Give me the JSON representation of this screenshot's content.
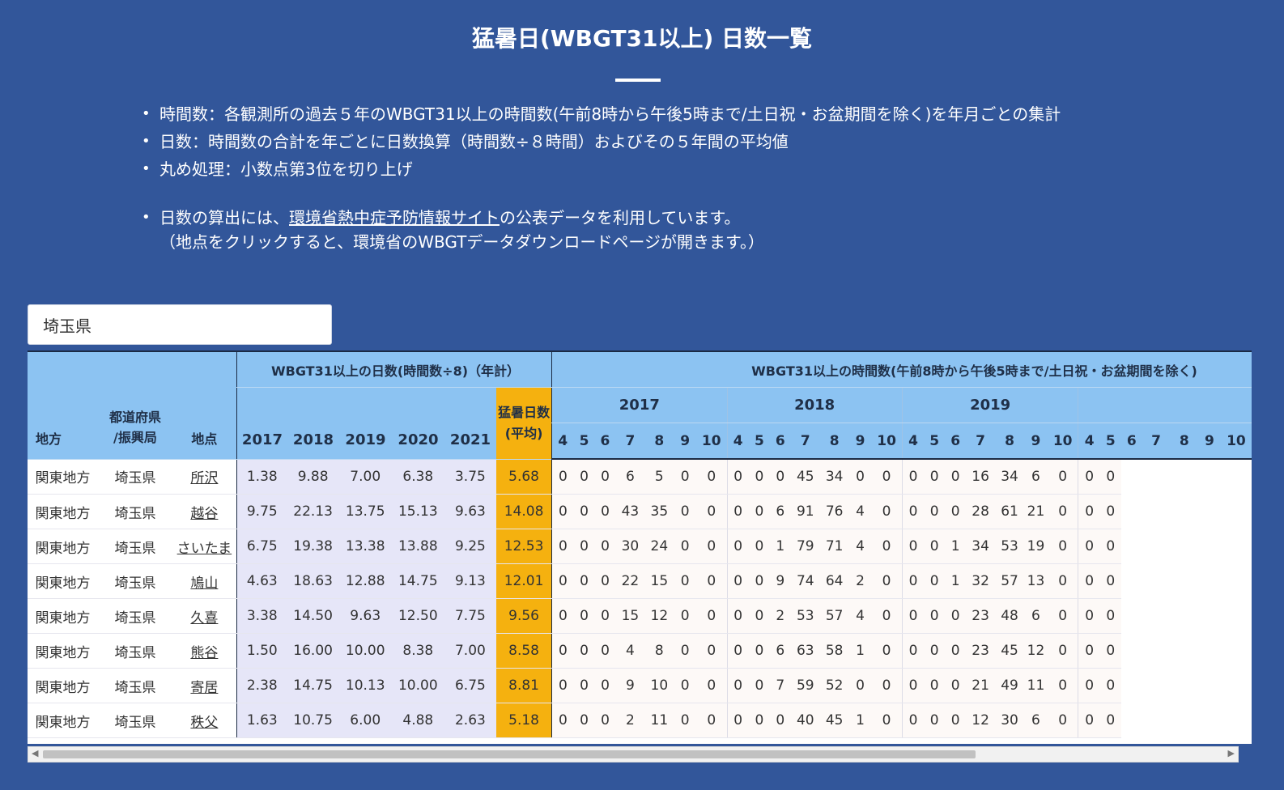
{
  "page": {
    "title": "猛暑日(WBGT31以上) 日数一覧",
    "notes": [
      "時間数：各観測所の過去５年のWBGT31以上の時間数(午前8時から午後5時まで/土日祝・お盆期間を除く)を年月ごとの集計",
      "日数：時間数の合計を年ごとに日数換算（時間数÷８時間）およびその５年間の平均値",
      "丸め処理：小数点第3位を切り上げ"
    ],
    "source_note_prefix": "日数の算出には、",
    "source_link": "環境省熱中症予防情報サイト",
    "source_note_suffix": "の公表データを利用しています。",
    "source_sub": "（地点をクリックすると、環境省のWBGTデータダウンロードページが開きます。）"
  },
  "filter": {
    "prefecture": "埼玉県"
  },
  "table": {
    "head": {
      "region": "地方",
      "pref": "都道府県\n/振興局",
      "site": "地点",
      "days_group": "WBGT31以上の日数(時間数÷8)（年計）",
      "hours_group": "WBGT31以上の時間数(午前8時から午後5時まで/土日祝・お盆期間を除く)",
      "avg": "猛暑日数\n(平均)",
      "day_years": [
        "2017",
        "2018",
        "2019",
        "2020",
        "2021"
      ],
      "hour_years": [
        "2017",
        "2018",
        "2019",
        ""
      ],
      "months": [
        "4",
        "5",
        "6",
        "7",
        "8",
        "9",
        "10"
      ]
    },
    "rows": [
      {
        "region": "関東地方",
        "pref": "埼玉県",
        "site": "所沢",
        "days": [
          "1.38",
          "9.88",
          "7.00",
          "6.38",
          "3.75"
        ],
        "avg": "5.68",
        "hours": [
          "0",
          "0",
          "0",
          "6",
          "5",
          "0",
          "0",
          "0",
          "0",
          "0",
          "45",
          "34",
          "0",
          "0",
          "0",
          "0",
          "0",
          "16",
          "34",
          "6",
          "0",
          "0",
          "0"
        ]
      },
      {
        "region": "関東地方",
        "pref": "埼玉県",
        "site": "越谷",
        "days": [
          "9.75",
          "22.13",
          "13.75",
          "15.13",
          "9.63"
        ],
        "avg": "14.08",
        "hours": [
          "0",
          "0",
          "0",
          "43",
          "35",
          "0",
          "0",
          "0",
          "0",
          "6",
          "91",
          "76",
          "4",
          "0",
          "0",
          "0",
          "0",
          "28",
          "61",
          "21",
          "0",
          "0",
          "0"
        ]
      },
      {
        "region": "関東地方",
        "pref": "埼玉県",
        "site": "さいたま",
        "days": [
          "6.75",
          "19.38",
          "13.38",
          "13.88",
          "9.25"
        ],
        "avg": "12.53",
        "hours": [
          "0",
          "0",
          "0",
          "30",
          "24",
          "0",
          "0",
          "0",
          "0",
          "1",
          "79",
          "71",
          "4",
          "0",
          "0",
          "0",
          "1",
          "34",
          "53",
          "19",
          "0",
          "0",
          "0"
        ]
      },
      {
        "region": "関東地方",
        "pref": "埼玉県",
        "site": "鳩山",
        "days": [
          "4.63",
          "18.63",
          "12.88",
          "14.75",
          "9.13"
        ],
        "avg": "12.01",
        "hours": [
          "0",
          "0",
          "0",
          "22",
          "15",
          "0",
          "0",
          "0",
          "0",
          "9",
          "74",
          "64",
          "2",
          "0",
          "0",
          "0",
          "1",
          "32",
          "57",
          "13",
          "0",
          "0",
          "0"
        ]
      },
      {
        "region": "関東地方",
        "pref": "埼玉県",
        "site": "久喜",
        "days": [
          "3.38",
          "14.50",
          "9.63",
          "12.50",
          "7.75"
        ],
        "avg": "9.56",
        "hours": [
          "0",
          "0",
          "0",
          "15",
          "12",
          "0",
          "0",
          "0",
          "0",
          "2",
          "53",
          "57",
          "4",
          "0",
          "0",
          "0",
          "0",
          "23",
          "48",
          "6",
          "0",
          "0",
          "0"
        ]
      },
      {
        "region": "関東地方",
        "pref": "埼玉県",
        "site": "熊谷",
        "days": [
          "1.50",
          "16.00",
          "10.00",
          "8.38",
          "7.00"
        ],
        "avg": "8.58",
        "hours": [
          "0",
          "0",
          "0",
          "4",
          "8",
          "0",
          "0",
          "0",
          "0",
          "6",
          "63",
          "58",
          "1",
          "0",
          "0",
          "0",
          "0",
          "23",
          "45",
          "12",
          "0",
          "0",
          "0"
        ]
      },
      {
        "region": "関東地方",
        "pref": "埼玉県",
        "site": "寄居",
        "days": [
          "2.38",
          "14.75",
          "10.13",
          "10.00",
          "6.75"
        ],
        "avg": "8.81",
        "hours": [
          "0",
          "0",
          "0",
          "9",
          "10",
          "0",
          "0",
          "0",
          "0",
          "7",
          "59",
          "52",
          "0",
          "0",
          "0",
          "0",
          "0",
          "21",
          "49",
          "11",
          "0",
          "0",
          "0"
        ]
      },
      {
        "region": "関東地方",
        "pref": "埼玉県",
        "site": "秩父",
        "days": [
          "1.63",
          "10.75",
          "6.00",
          "4.88",
          "2.63"
        ],
        "avg": "5.18",
        "hours": [
          "0",
          "0",
          "0",
          "2",
          "11",
          "0",
          "0",
          "0",
          "0",
          "0",
          "40",
          "45",
          "1",
          "0",
          "0",
          "0",
          "0",
          "12",
          "30",
          "6",
          "0",
          "0",
          "0"
        ]
      }
    ]
  },
  "scrollbar": {
    "left_arrow": "◀",
    "right_arrow": "▶"
  }
}
